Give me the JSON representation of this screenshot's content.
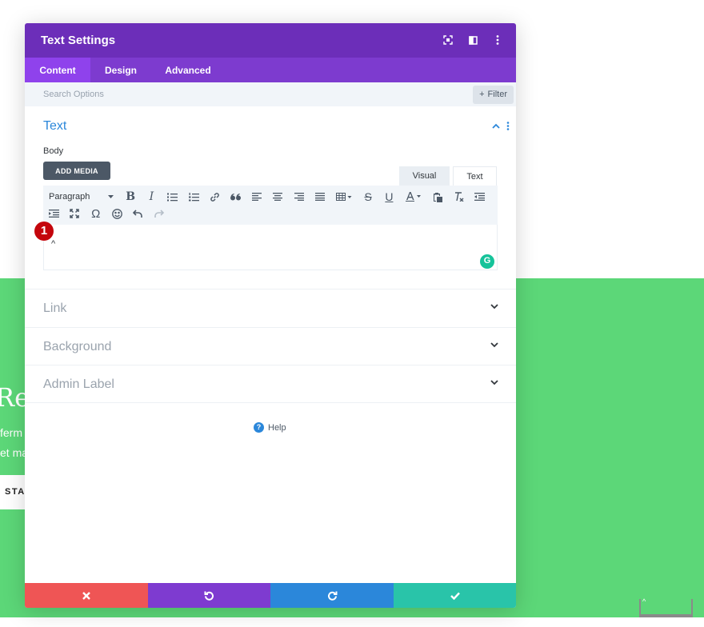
{
  "background": {
    "heading": "Re",
    "line1": "ferm",
    "line2": "et ma",
    "cta": "STA",
    "corner_glyph": "^",
    "green_color": "#5cd778"
  },
  "modal": {
    "title": "Text Settings",
    "header_color": "#6c2eb9",
    "header_icons": [
      "fullscreen-icon",
      "split-view-icon",
      "more-vertical-icon"
    ],
    "tabs": [
      {
        "label": "Content",
        "active": true
      },
      {
        "label": "Design",
        "active": false
      },
      {
        "label": "Advanced",
        "active": false
      }
    ],
    "search": {
      "placeholder": "Search Options",
      "filter_label": "Filter",
      "filter_icon": "plus-icon"
    },
    "text_section": {
      "title": "Text",
      "body_label": "Body",
      "add_media_label": "ADD MEDIA",
      "editor_tabs": {
        "visual": "Visual",
        "text": "Text"
      },
      "format_select": "Paragraph",
      "editor_content": "^",
      "marker_number": "1"
    },
    "sections": [
      {
        "title": "Link"
      },
      {
        "title": "Background"
      },
      {
        "title": "Admin Label"
      }
    ],
    "help_label": "Help",
    "footer": {
      "buttons": [
        {
          "action": "discard",
          "icon": "close-icon",
          "color": "#ef5555"
        },
        {
          "action": "undo",
          "icon": "undo-icon",
          "color": "#7e3bd0"
        },
        {
          "action": "redo",
          "icon": "redo-icon",
          "color": "#2b87da"
        },
        {
          "action": "save",
          "icon": "check-icon",
          "color": "#29c4a9"
        }
      ]
    }
  }
}
